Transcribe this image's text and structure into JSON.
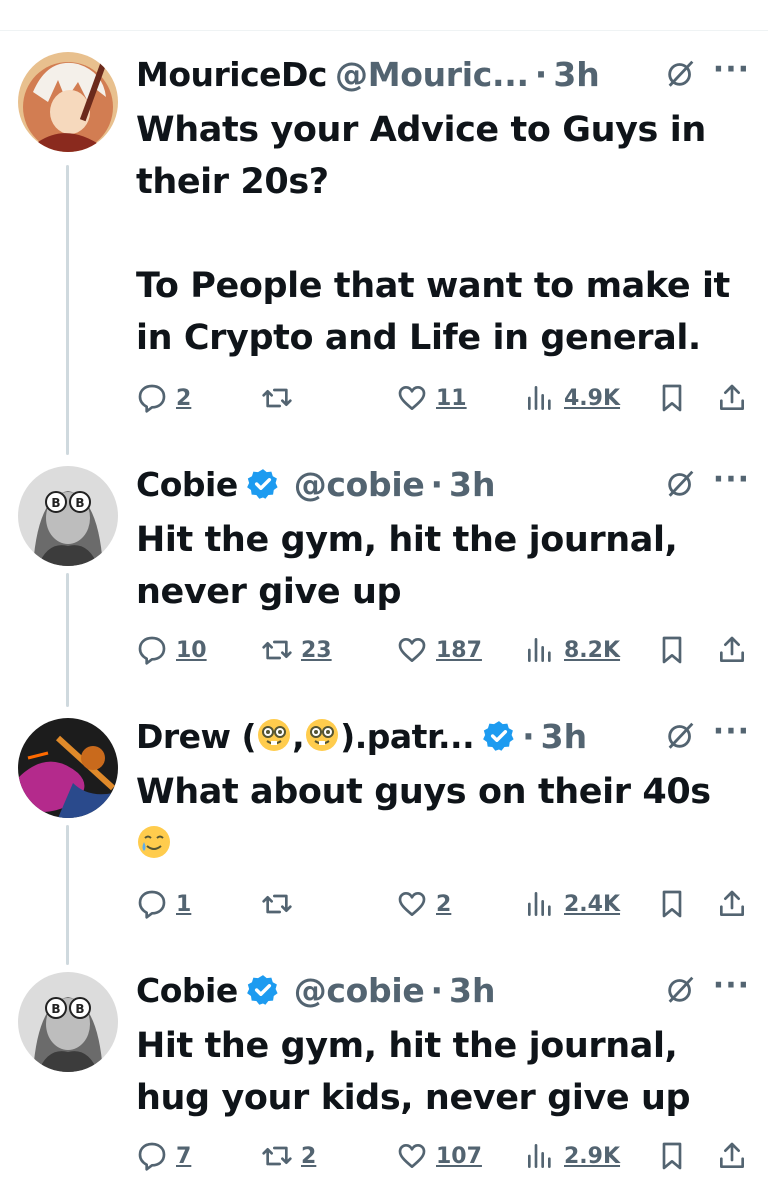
{
  "tweets": [
    {
      "name": "MouriceDc",
      "handle": "@Mouric...",
      "sep": "·",
      "time": "3h",
      "verified": false,
      "text": [
        "Whats your Advice to Guys in their 20s?",
        "To People that want to make it in Crypto and Life in general."
      ],
      "replies": "2",
      "retweets": "",
      "likes": "11",
      "views": "4.9K",
      "avatar": "anime-character-avatar"
    },
    {
      "name": "Cobie",
      "handle": "@cobie",
      "sep": "·",
      "time": "3h",
      "verified": true,
      "text": [
        "Hit the gym, hit the journal, never give up"
      ],
      "replies": "10",
      "retweets": "23",
      "likes": "187",
      "views": "8.2K",
      "avatar": "bitcoin-glasses-avatar"
    },
    {
      "name_pre": "Drew (",
      "name_mid": ",",
      "name_post": ").patr...",
      "handle": "",
      "sep": "·",
      "time": "3h",
      "verified": true,
      "text_line1": "What about guys on their 40s",
      "replies": "1",
      "retweets": "",
      "likes": "2",
      "views": "2.4K",
      "avatar": "guitar-art-avatar"
    },
    {
      "name": "Cobie",
      "handle": "@cobie",
      "sep": "·",
      "time": "3h",
      "verified": true,
      "text": [
        "Hit the gym, hit the journal, hug your kids, never give up"
      ],
      "replies": "7",
      "retweets": "2",
      "likes": "107",
      "views": "2.9K",
      "avatar": "bitcoin-glasses-avatar"
    }
  ],
  "colors": {
    "verified": "#1d9bf0",
    "muted": "#536471",
    "thread_line": "#cfd9de"
  }
}
